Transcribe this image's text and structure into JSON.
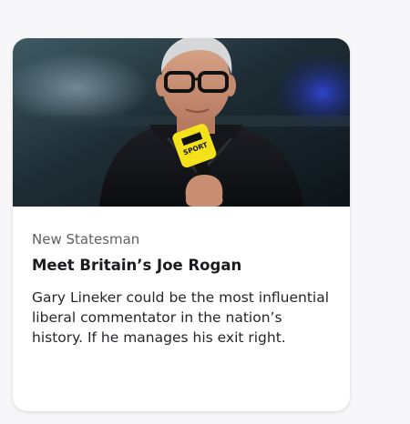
{
  "card": {
    "image_alt": "Presenter holding a BBC Sport microphone",
    "mic_flag_text_top": "BBC",
    "mic_flag_text_bottom": "SPORT",
    "source": "New Statesman",
    "title": "Meet Britain’s Joe Rogan",
    "snippet": "Gary Lineker could be the most influential liberal commentator in the nation’s history. If he manages his exit right."
  },
  "colors": {
    "page_background": "#f7f7fa",
    "card_background": "#ffffff",
    "mic_flag": "#f3e21b"
  }
}
